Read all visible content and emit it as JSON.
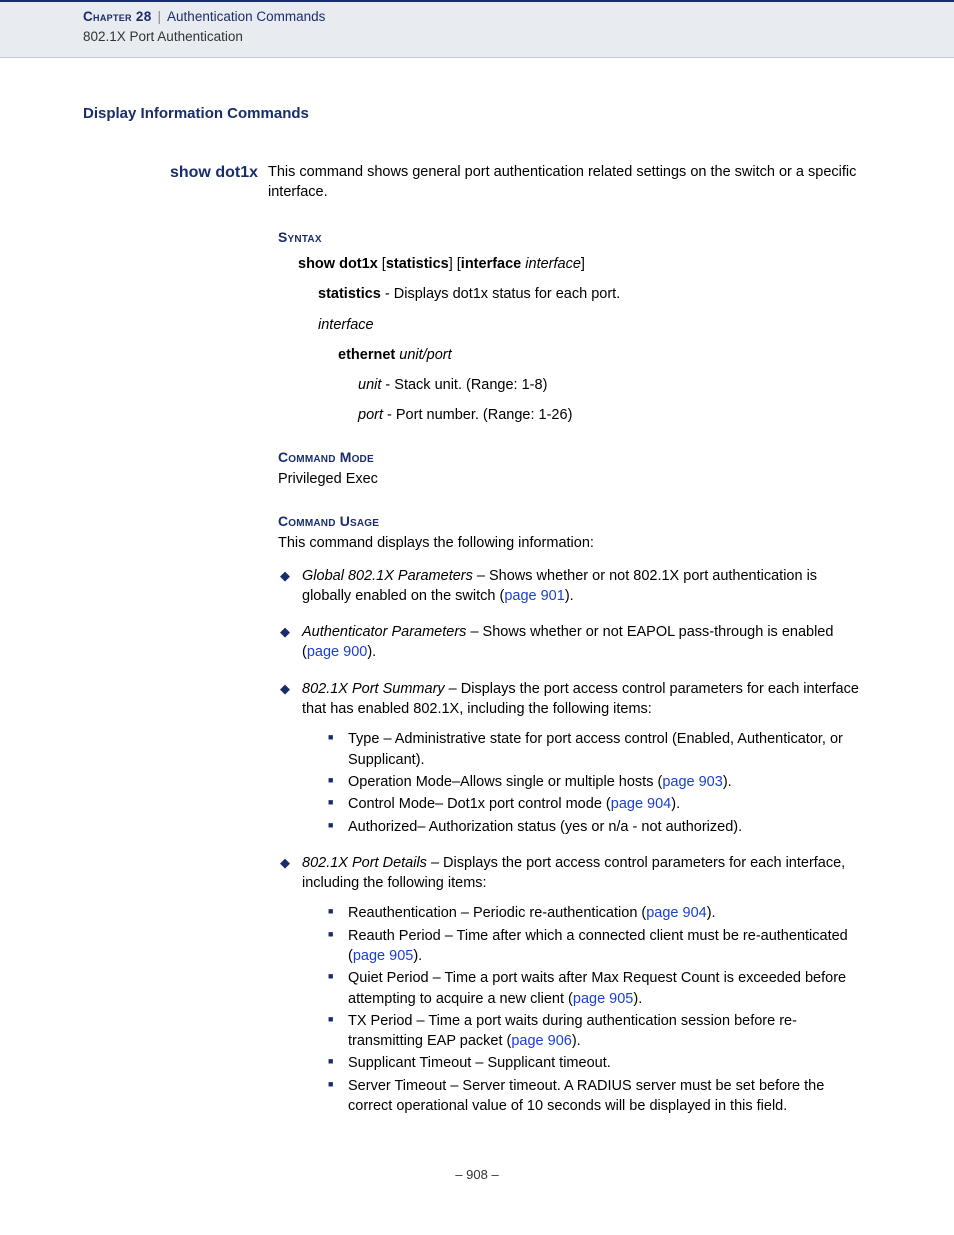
{
  "header": {
    "chapter_label": "Chapter 28",
    "chapter_title": "Authentication Commands",
    "chapter_sub": "802.1X Port Authentication"
  },
  "section_title": "Display Information Commands",
  "command": {
    "name": "show dot1x",
    "description": "This command shows general port authentication related settings on the switch or a specific interface."
  },
  "syntax": {
    "heading": "Syntax",
    "line_prefix": "show dot1x",
    "opt1": "statistics",
    "opt2_label": "interface",
    "opt2_arg": "interface",
    "statistics_label": "statistics",
    "statistics_desc": " - Displays dot1x status for each port.",
    "interface_label": "interface",
    "ethernet_label": "ethernet",
    "ethernet_arg": "unit/port",
    "unit_label": "unit",
    "unit_desc": " - Stack unit. (Range: 1-8)",
    "port_label": "port",
    "port_desc": " - Port number. (Range: 1-26)"
  },
  "command_mode": {
    "heading": "Command Mode",
    "text": "Privileged Exec"
  },
  "usage": {
    "heading": "Command Usage",
    "intro": "This command displays the following information:",
    "items": [
      {
        "title": "Global 802.1X Parameters",
        "text": " – Shows whether or not 802.1X port authentication is globally enabled on the switch (",
        "link": "page 901",
        "tail": ")."
      },
      {
        "title": "Authenticator Parameters",
        "text": " – Shows whether or not EAPOL pass-through is enabled (",
        "link": "page 900",
        "tail": ")."
      },
      {
        "title": "802.1X Port Summary",
        "text": " – Displays the port access control parameters for each interface that has enabled 802.1X, including the following items:",
        "sub": [
          {
            "t": "Type – Administrative state for port access control (Enabled, Authenticator, or Supplicant)."
          },
          {
            "t": "Operation Mode–Allows single or multiple hosts (",
            "link": "page 903",
            "tail": ")."
          },
          {
            "t": "Control Mode– Dot1x port control mode (",
            "link": "page 904",
            "tail": ")."
          },
          {
            "t": "Authorized– Authorization status (yes or n/a - not authorized)."
          }
        ]
      },
      {
        "title": "802.1X Port Details",
        "text": " – Displays the port access control parameters for each interface, including the following items:",
        "sub": [
          {
            "t": "Reauthentication – Periodic re-authentication (",
            "link": "page 904",
            "tail": ")."
          },
          {
            "t": "Reauth Period – Time after which a connected client must be re-authenticated (",
            "link": "page 905",
            "tail": ")."
          },
          {
            "t": "Quiet Period – Time a port waits after Max Request Count is exceeded before attempting to acquire a new client (",
            "link": "page 905",
            "tail": ")."
          },
          {
            "t": "TX Period – Time a port waits during authentication session before re-transmitting EAP packet (",
            "link": "page 906",
            "tail": ")."
          },
          {
            "t": "Supplicant Timeout – Supplicant timeout."
          },
          {
            "t": "Server Timeout – Server timeout. A RADIUS server must be set before the correct operational value of 10 seconds will be displayed in this field."
          }
        ]
      }
    ]
  },
  "footer": {
    "page_no": "–  908  –"
  }
}
